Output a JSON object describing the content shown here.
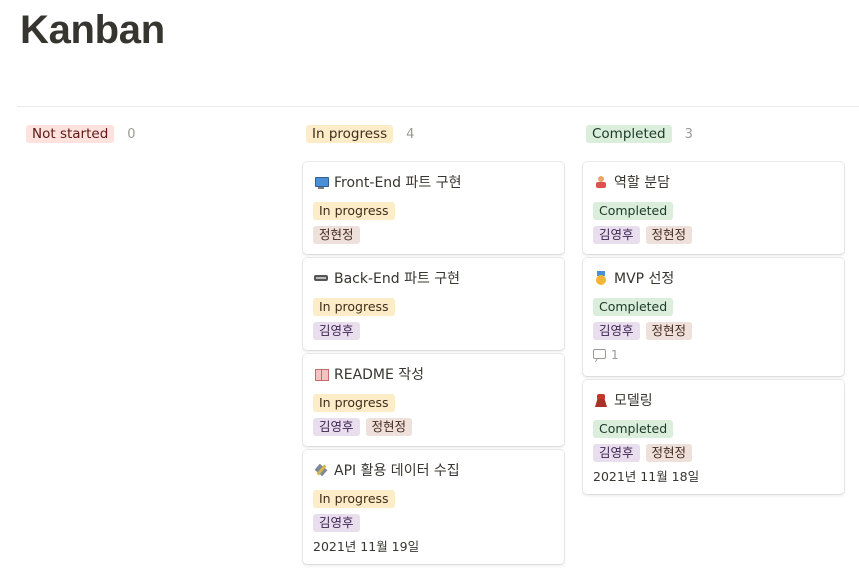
{
  "page_title": "Kanban",
  "columns": [
    {
      "status": "Not started",
      "count": "0",
      "cards": []
    },
    {
      "status": "In progress",
      "count": "4",
      "cards": [
        {
          "icon": "monitor-icon",
          "title": "Front-End 파트 구현",
          "status": "In progress",
          "people": [
            "정현정"
          ]
        },
        {
          "icon": "keyboard-icon",
          "title": "Back-End 파트 구현",
          "status": "In progress",
          "people": [
            "김영후"
          ]
        },
        {
          "icon": "book-icon",
          "title": "README 작성",
          "status": "In progress",
          "people": [
            "김영후",
            "정현정"
          ]
        },
        {
          "icon": "satellite-icon",
          "title": "API 활용 데이터 수집",
          "status": "In progress",
          "people": [
            "김영후"
          ],
          "date": "2021년 11월 19일"
        }
      ]
    },
    {
      "status": "Completed",
      "count": "3",
      "cards": [
        {
          "icon": "wrestling-icon",
          "title": "역할 분담",
          "status": "Completed",
          "people": [
            "김영후",
            "정현정"
          ]
        },
        {
          "icon": "medal-icon",
          "title": "MVP 선정",
          "status": "Completed",
          "people": [
            "김영후",
            "정현정"
          ],
          "comments": "1"
        },
        {
          "icon": "dress-icon",
          "title": "모델링",
          "status": "Completed",
          "people": [
            "김영후",
            "정현정"
          ],
          "date": "2021년 11월 18일"
        }
      ]
    }
  ],
  "colors": {
    "not_started_bg": "#ffe2dd",
    "in_progress_bg": "#fdecc8",
    "completed_bg": "#dbeddb",
    "person_kim_bg": "#e8deee",
    "person_jung_bg": "#eee0da"
  }
}
